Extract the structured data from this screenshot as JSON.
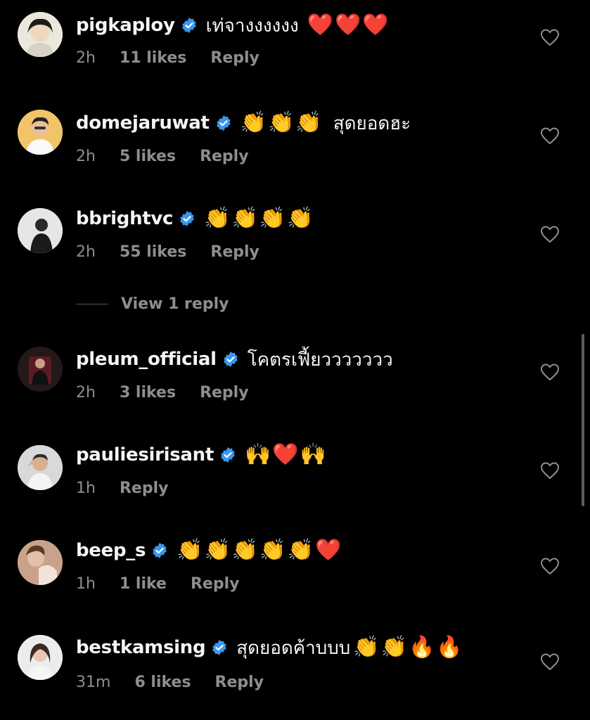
{
  "comments": [
    {
      "username": "pigkaploy",
      "text": "เท่จางงงงงง",
      "emojis": "❤️❤️❤️",
      "time": "2h",
      "likes": "11 likes",
      "reply": "Reply"
    },
    {
      "username": "domejaruwat",
      "text": "สุดยอดฮะ",
      "emojis": "👏👏👏",
      "emoji_position": "before_text",
      "time": "2h",
      "likes": "5 likes",
      "reply": "Reply"
    },
    {
      "username": "bbrightvc",
      "text": "",
      "emojis": "👏👏👏👏",
      "time": "2h",
      "likes": "55 likes",
      "reply": "Reply"
    },
    {
      "username": "pleum_official",
      "text": "โคตรเฟี้ยววววววว",
      "emojis": "",
      "time": "2h",
      "likes": "3 likes",
      "reply": "Reply"
    },
    {
      "username": "pauliesirisant",
      "text": "",
      "emojis": "🙌❤️🙌",
      "time": "1h",
      "likes": "",
      "reply": "Reply"
    },
    {
      "username": "beep_s",
      "text": "",
      "emojis": "👏👏👏👏👏❤️",
      "time": "1h",
      "likes": "1 like",
      "reply": "Reply"
    },
    {
      "username": "bestkamsing",
      "text": "สุดยอดค้าบบบ",
      "emojis": "👏👏🔥🔥",
      "time": "31m",
      "likes": "6 likes",
      "reply": "Reply"
    }
  ],
  "view_replies": "View 1 reply",
  "colors": {
    "background": "#000000",
    "text": "#f5f5f5",
    "meta": "#8e8e8e",
    "verified": "#3897f0"
  },
  "icons": {
    "verified": "verified-badge-icon",
    "like": "heart-outline-icon"
  }
}
